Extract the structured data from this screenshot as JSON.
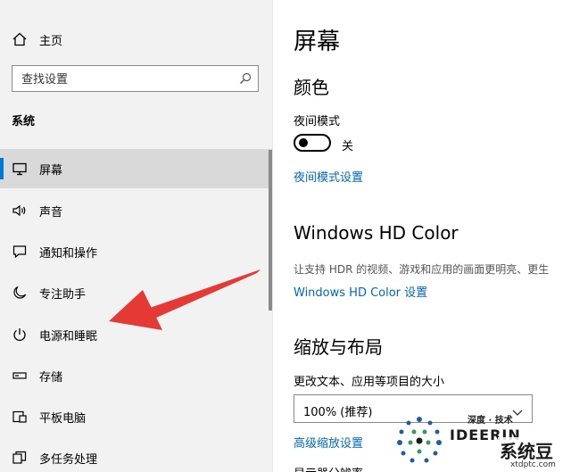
{
  "sidebar": {
    "home_label": "主页",
    "search_placeholder": "查找设置",
    "section_label": "系统",
    "items": [
      {
        "label": "屏幕"
      },
      {
        "label": "声音"
      },
      {
        "label": "通知和操作"
      },
      {
        "label": "专注助手"
      },
      {
        "label": "电源和睡眠"
      },
      {
        "label": "存储"
      },
      {
        "label": "平板电脑"
      },
      {
        "label": "多任务处理"
      }
    ]
  },
  "main": {
    "title": "屏幕",
    "color_heading": "颜色",
    "night_mode_label": "夜间模式",
    "night_mode_state": "关",
    "night_mode_link": "夜间模式设置",
    "hd_heading": "Windows HD Color",
    "hd_desc": "让支持 HDR 的视频、游戏和应用的画面更明亮、更生",
    "hd_link": "Windows HD Color 设置",
    "scale_heading": "缩放与布局",
    "scale_label": "更改文本、应用等项目的大小",
    "scale_value": "100% (推荐)",
    "advanced_link": "高级缩放设置",
    "partial_text": "显示器分辨率"
  },
  "watermark": {
    "top_text": "深度 · 技术",
    "brand": "IDEERIN",
    "cn_name": "系统豆",
    "url": "xtdptc.com"
  },
  "colors": {
    "accent": "#0078d7",
    "link": "#0067b8",
    "arrow": "#e53935"
  }
}
